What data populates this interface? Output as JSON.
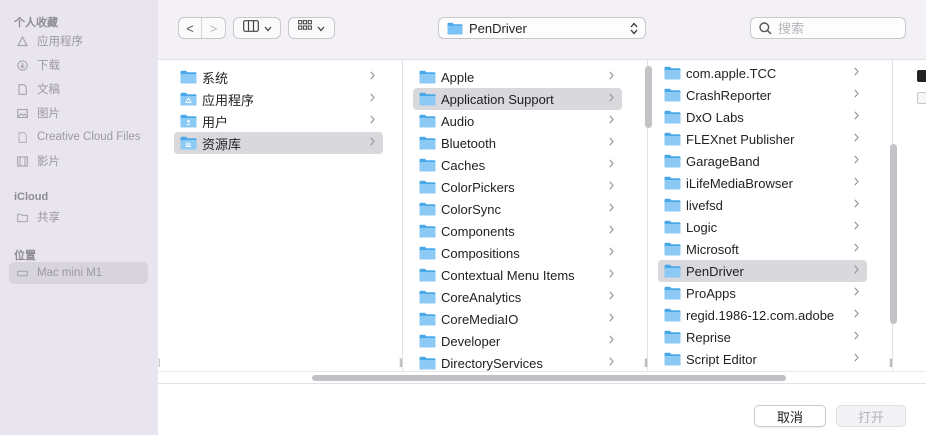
{
  "sidebar": {
    "favorites_header": "个人收藏",
    "favorites": [
      {
        "label": "应用程序",
        "icon": "apps-icon"
      },
      {
        "label": "下载",
        "icon": "download-icon"
      },
      {
        "label": "文稿",
        "icon": "document-icon"
      },
      {
        "label": "图片",
        "icon": "photo-icon"
      },
      {
        "label": "Creative Cloud Files",
        "icon": "file-icon"
      },
      {
        "label": "影片",
        "icon": "film-icon"
      }
    ],
    "icloud_header": "iCloud",
    "icloud": [
      {
        "label": "共享",
        "icon": "shared-folder-icon"
      }
    ],
    "locations_header": "位置",
    "locations": [
      {
        "label": "Mac mini M1",
        "icon": "computer-icon",
        "selected": true
      }
    ]
  },
  "toolbar": {
    "back": "<",
    "forward": ">",
    "current_folder": "PenDriver",
    "search_placeholder": "搜索"
  },
  "columns": [
    {
      "items": [
        {
          "label": "系统",
          "icon": "folder"
        },
        {
          "label": "应用程序",
          "icon": "apps-folder"
        },
        {
          "label": "用户",
          "icon": "users-folder"
        },
        {
          "label": "资源库",
          "icon": "library-folder",
          "selected": true
        }
      ]
    },
    {
      "items": [
        {
          "label": "Apple"
        },
        {
          "label": "Application Support",
          "selected": true
        },
        {
          "label": "Audio"
        },
        {
          "label": "Bluetooth"
        },
        {
          "label": "Caches"
        },
        {
          "label": "ColorPickers"
        },
        {
          "label": "ColorSync"
        },
        {
          "label": "Components"
        },
        {
          "label": "Compositions"
        },
        {
          "label": "Contextual Menu Items"
        },
        {
          "label": "CoreAnalytics"
        },
        {
          "label": "CoreMediaIO"
        },
        {
          "label": "Developer"
        },
        {
          "label": "DirectoryServices"
        }
      ]
    },
    {
      "items": [
        {
          "label": "com.apple.TCC"
        },
        {
          "label": "CrashReporter"
        },
        {
          "label": "DxO Labs"
        },
        {
          "label": "FLEXnet Publisher"
        },
        {
          "label": "GarageBand"
        },
        {
          "label": "iLifeMediaBrowser"
        },
        {
          "label": "livefsd"
        },
        {
          "label": "Logic"
        },
        {
          "label": "Microsoft"
        },
        {
          "label": "PenDriver",
          "selected": true
        },
        {
          "label": "ProApps"
        },
        {
          "label": "regid.1986-12.com.adobe"
        },
        {
          "label": "Reprise"
        },
        {
          "label": "Script Editor"
        }
      ]
    }
  ],
  "footer": {
    "cancel": "取消",
    "open": "打开"
  },
  "colors": {
    "folder_blue": "#4aa8ea",
    "folder_light": "#8ccaf5",
    "selection": "#d9d8dc"
  }
}
